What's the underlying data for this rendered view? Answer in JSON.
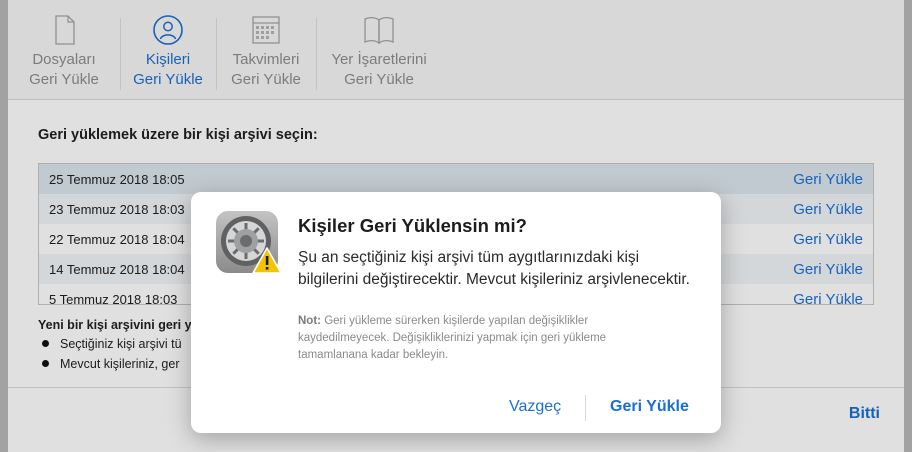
{
  "toolbar": {
    "tabs": [
      {
        "line1": "Dosyaları",
        "line2": "Geri Yükle",
        "icon": "document-icon",
        "active": false
      },
      {
        "line1": "Kişileri",
        "line2": "Geri Yükle",
        "icon": "contacts-icon",
        "active": true
      },
      {
        "line1": "Takvimleri",
        "line2": "Geri Yükle",
        "icon": "calendar-icon",
        "active": false
      },
      {
        "line1": "Yer İşaretlerini",
        "line2": "Geri Yükle",
        "icon": "bookmarks-icon",
        "active": false
      }
    ]
  },
  "main": {
    "prompt": "Geri yüklemek üzere bir kişi arşivi seçin:",
    "archives": [
      {
        "date": "25 Temmuz 2018 18:05",
        "action": "Geri Yükle"
      },
      {
        "date": "23 Temmuz 2018 18:03",
        "action": "Geri Yükle"
      },
      {
        "date": "22 Temmuz 2018 18:04",
        "action": "Geri Yükle"
      },
      {
        "date": "14 Temmuz 2018 18:04",
        "action": "Geri Yükle"
      },
      {
        "date": "5 Temmuz 2018 18:03",
        "action": "Geri Yükle"
      }
    ],
    "info_title": "Yeni bir kişi arşivini geri y",
    "bullets": [
      "Seçtiğiniz kişi arşivi tü",
      "Mevcut kişileriniz, ger"
    ],
    "done_label": "Bitti"
  },
  "dialog": {
    "icon": "system-preferences-warning-icon",
    "title": "Kişiler Geri Yüklensin mi?",
    "body": "Şu an seçtiğiniz kişi arşivi tüm aygıtlarınızdaki kişi bilgilerini değiştirecektir. Mevcut kişileriniz arşivlenecektir.",
    "note_label": "Not:",
    "note_text": " Geri yükleme sürerken kişilerde yapılan değişiklikler kaydedilmeyecek. Değişikliklerinizi yapmak için geri yükleme tamamlanana kadar bekleyin.",
    "cancel_label": "Vazgeç",
    "confirm_label": "Geri Yükle"
  },
  "colors": {
    "accent": "#1a6fd6",
    "selected_row": "#dde6ee",
    "warning": "#f5c400"
  }
}
